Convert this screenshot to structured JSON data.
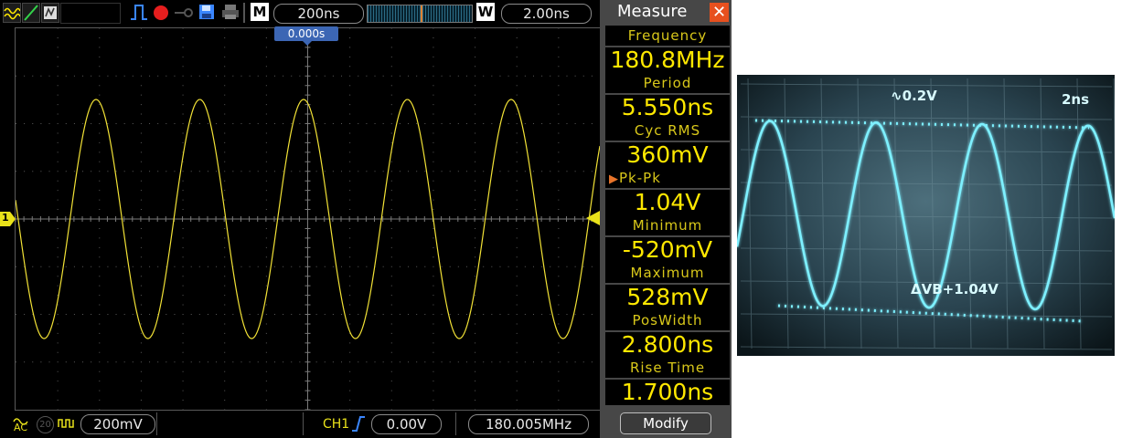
{
  "toolbar": {
    "timebase": "200ns",
    "memory_button": "M",
    "window_button": "W",
    "window_timebase": "2.00ns",
    "icons": [
      "waveform-icon",
      "cursor-icon",
      "persist-icon",
      "pulse-trigger-icon",
      "record-icon",
      "key-icon",
      "save-icon",
      "print-icon"
    ]
  },
  "trigger_position": "0.000s",
  "channel_marker": "1",
  "status_bar": {
    "coupling": "AC",
    "bw_limit": "20",
    "ch1_scale": "200mV",
    "trigger_source": "CH1",
    "trigger_level": "0.00V",
    "frequency_counter": "180.005MHz"
  },
  "measure": {
    "title": "Measure",
    "items": [
      {
        "label": "Frequency",
        "value": "180.8MHz"
      },
      {
        "label": "Period",
        "value": "5.550ns"
      },
      {
        "label": "Cyc RMS",
        "value": "360mV"
      },
      {
        "label": "Pk-Pk",
        "value": "1.04V",
        "selected": true
      },
      {
        "label": "Minimum",
        "value": "-520mV"
      },
      {
        "label": "Maximum",
        "value": "528mV"
      },
      {
        "label": "PosWidth",
        "value": "2.800ns"
      },
      {
        "label": "Rise Time",
        "value": "1.700ns"
      }
    ],
    "modify_label": "Modify"
  },
  "photo": {
    "volts_div": "∿0.2V",
    "time_div": "2ns",
    "delta_readout": "ΔVB+1.04V"
  },
  "colors": {
    "trace": "#f2e236",
    "grid": "#5a5a5a",
    "measure_text": "#ffe800",
    "trigger_badge": "#3c66b4",
    "close_button": "#e7501e",
    "photo_trace": "#7ef0ff"
  }
}
